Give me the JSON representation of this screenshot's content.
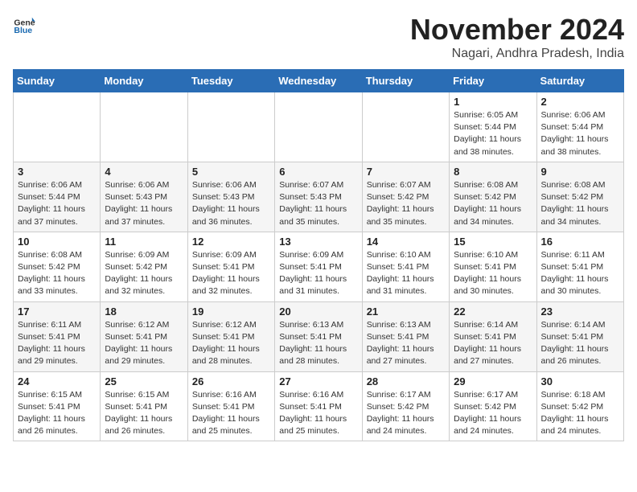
{
  "header": {
    "logo_line1": "General",
    "logo_line2": "Blue",
    "month": "November 2024",
    "location": "Nagari, Andhra Pradesh, India"
  },
  "weekdays": [
    "Sunday",
    "Monday",
    "Tuesday",
    "Wednesday",
    "Thursday",
    "Friday",
    "Saturday"
  ],
  "weeks": [
    [
      {
        "day": "",
        "info": ""
      },
      {
        "day": "",
        "info": ""
      },
      {
        "day": "",
        "info": ""
      },
      {
        "day": "",
        "info": ""
      },
      {
        "day": "",
        "info": ""
      },
      {
        "day": "1",
        "info": "Sunrise: 6:05 AM\nSunset: 5:44 PM\nDaylight: 11 hours and 38 minutes."
      },
      {
        "day": "2",
        "info": "Sunrise: 6:06 AM\nSunset: 5:44 PM\nDaylight: 11 hours and 38 minutes."
      }
    ],
    [
      {
        "day": "3",
        "info": "Sunrise: 6:06 AM\nSunset: 5:44 PM\nDaylight: 11 hours and 37 minutes."
      },
      {
        "day": "4",
        "info": "Sunrise: 6:06 AM\nSunset: 5:43 PM\nDaylight: 11 hours and 37 minutes."
      },
      {
        "day": "5",
        "info": "Sunrise: 6:06 AM\nSunset: 5:43 PM\nDaylight: 11 hours and 36 minutes."
      },
      {
        "day": "6",
        "info": "Sunrise: 6:07 AM\nSunset: 5:43 PM\nDaylight: 11 hours and 35 minutes."
      },
      {
        "day": "7",
        "info": "Sunrise: 6:07 AM\nSunset: 5:42 PM\nDaylight: 11 hours and 35 minutes."
      },
      {
        "day": "8",
        "info": "Sunrise: 6:08 AM\nSunset: 5:42 PM\nDaylight: 11 hours and 34 minutes."
      },
      {
        "day": "9",
        "info": "Sunrise: 6:08 AM\nSunset: 5:42 PM\nDaylight: 11 hours and 34 minutes."
      }
    ],
    [
      {
        "day": "10",
        "info": "Sunrise: 6:08 AM\nSunset: 5:42 PM\nDaylight: 11 hours and 33 minutes."
      },
      {
        "day": "11",
        "info": "Sunrise: 6:09 AM\nSunset: 5:42 PM\nDaylight: 11 hours and 32 minutes."
      },
      {
        "day": "12",
        "info": "Sunrise: 6:09 AM\nSunset: 5:41 PM\nDaylight: 11 hours and 32 minutes."
      },
      {
        "day": "13",
        "info": "Sunrise: 6:09 AM\nSunset: 5:41 PM\nDaylight: 11 hours and 31 minutes."
      },
      {
        "day": "14",
        "info": "Sunrise: 6:10 AM\nSunset: 5:41 PM\nDaylight: 11 hours and 31 minutes."
      },
      {
        "day": "15",
        "info": "Sunrise: 6:10 AM\nSunset: 5:41 PM\nDaylight: 11 hours and 30 minutes."
      },
      {
        "day": "16",
        "info": "Sunrise: 6:11 AM\nSunset: 5:41 PM\nDaylight: 11 hours and 30 minutes."
      }
    ],
    [
      {
        "day": "17",
        "info": "Sunrise: 6:11 AM\nSunset: 5:41 PM\nDaylight: 11 hours and 29 minutes."
      },
      {
        "day": "18",
        "info": "Sunrise: 6:12 AM\nSunset: 5:41 PM\nDaylight: 11 hours and 29 minutes."
      },
      {
        "day": "19",
        "info": "Sunrise: 6:12 AM\nSunset: 5:41 PM\nDaylight: 11 hours and 28 minutes."
      },
      {
        "day": "20",
        "info": "Sunrise: 6:13 AM\nSunset: 5:41 PM\nDaylight: 11 hours and 28 minutes."
      },
      {
        "day": "21",
        "info": "Sunrise: 6:13 AM\nSunset: 5:41 PM\nDaylight: 11 hours and 27 minutes."
      },
      {
        "day": "22",
        "info": "Sunrise: 6:14 AM\nSunset: 5:41 PM\nDaylight: 11 hours and 27 minutes."
      },
      {
        "day": "23",
        "info": "Sunrise: 6:14 AM\nSunset: 5:41 PM\nDaylight: 11 hours and 26 minutes."
      }
    ],
    [
      {
        "day": "24",
        "info": "Sunrise: 6:15 AM\nSunset: 5:41 PM\nDaylight: 11 hours and 26 minutes."
      },
      {
        "day": "25",
        "info": "Sunrise: 6:15 AM\nSunset: 5:41 PM\nDaylight: 11 hours and 26 minutes."
      },
      {
        "day": "26",
        "info": "Sunrise: 6:16 AM\nSunset: 5:41 PM\nDaylight: 11 hours and 25 minutes."
      },
      {
        "day": "27",
        "info": "Sunrise: 6:16 AM\nSunset: 5:41 PM\nDaylight: 11 hours and 25 minutes."
      },
      {
        "day": "28",
        "info": "Sunrise: 6:17 AM\nSunset: 5:42 PM\nDaylight: 11 hours and 24 minutes."
      },
      {
        "day": "29",
        "info": "Sunrise: 6:17 AM\nSunset: 5:42 PM\nDaylight: 11 hours and 24 minutes."
      },
      {
        "day": "30",
        "info": "Sunrise: 6:18 AM\nSunset: 5:42 PM\nDaylight: 11 hours and 24 minutes."
      }
    ]
  ]
}
